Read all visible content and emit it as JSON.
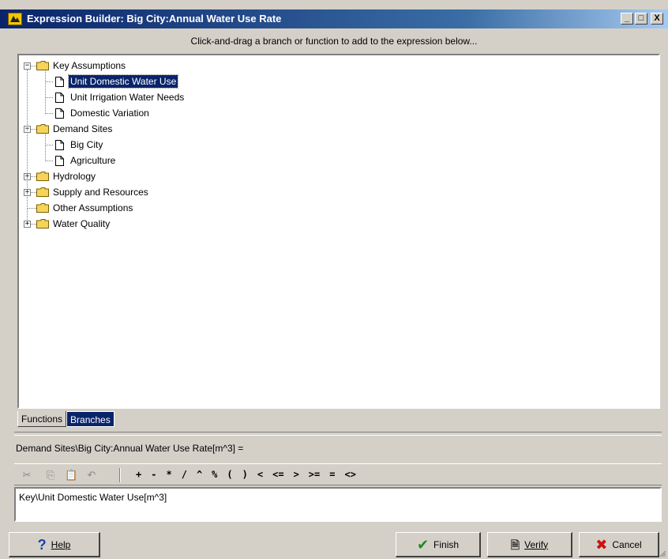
{
  "window": {
    "title": "Expression Builder: Big City:Annual Water Use Rate",
    "title_buttons": [
      "_",
      "□",
      "X"
    ]
  },
  "instruction": "Click-and-drag a branch or function to add to the expression below...",
  "tree": {
    "nodes": [
      {
        "label": "Key Assumptions",
        "type": "folder",
        "expander": "−"
      },
      {
        "label": "Unit Domestic Water Use",
        "type": "file",
        "selected": true
      },
      {
        "label": "Unit Irrigation Water Needs",
        "type": "file"
      },
      {
        "label": "Domestic Variation",
        "type": "file"
      },
      {
        "label": "Demand Sites",
        "type": "folder",
        "expander": "−"
      },
      {
        "label": "Big City",
        "type": "file"
      },
      {
        "label": "Agriculture",
        "type": "file"
      },
      {
        "label": "Hydrology",
        "type": "folder",
        "expander": "+"
      },
      {
        "label": "Supply and Resources",
        "type": "folder",
        "expander": "+"
      },
      {
        "label": "Other Assumptions",
        "type": "folder",
        "expander": ""
      },
      {
        "label": "Water Quality",
        "type": "folder",
        "expander": "+"
      }
    ]
  },
  "tabs": [
    {
      "label": "Functions",
      "active": false
    },
    {
      "label": "Branches",
      "active": true
    }
  ],
  "expression": {
    "target_label": "Demand Sites\\Big City:Annual Water Use Rate[m^3] =",
    "value": "Key\\Unit Domestic Water Use[m^3]"
  },
  "toolbar": {
    "edit_icons": [
      "cut-icon",
      "copy-icon",
      "paste-icon",
      "undo-icon"
    ],
    "operators": [
      "+",
      "-",
      "*",
      "/",
      "^",
      "%",
      "(",
      ")",
      "<",
      "<=",
      ">",
      ">=",
      "=",
      "<>"
    ]
  },
  "buttons": {
    "help": "Help",
    "finish": "Finish",
    "verify": "Verify",
    "cancel": "Cancel"
  },
  "colors": {
    "title_bar": "#0a246a",
    "selection": "#0a246a",
    "window_bg": "#d4d0c8",
    "folder": "#f4d55a",
    "finish_check": "#1e8c1e",
    "cancel_x": "#cc1111",
    "help_icon": "#1a3fb0"
  }
}
